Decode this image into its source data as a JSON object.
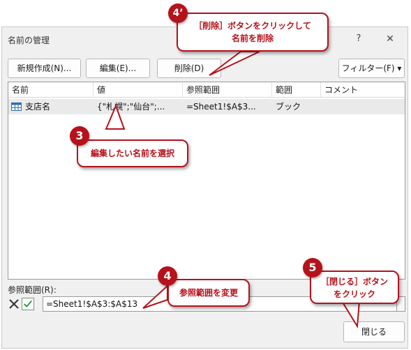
{
  "dialog": {
    "title": "名前の管理",
    "help": "?",
    "close_glyph": "✕"
  },
  "toolbar": {
    "new_label": "新規作成(N)...",
    "edit_label": "編集(E)...",
    "delete_label": "削除(D)",
    "filter_label": "フィルター(F) ▾"
  },
  "list": {
    "columns": [
      "名前",
      "値",
      "参照範囲",
      "範囲",
      "コメント"
    ],
    "rows": [
      {
        "name": "支店名",
        "value": "{\"札幌\";\"仙台\";...",
        "ref": "=Sheet1!$A$3...",
        "scope": "ブック",
        "comment": ""
      }
    ]
  },
  "reference": {
    "label": "参照範囲(R):",
    "value": "=Sheet1!$A$3:$A$13"
  },
  "footer": {
    "close_label": "閉じる"
  },
  "annotations": {
    "step3_number": "3",
    "step3_text": "編集したい名前を選択",
    "step4_number": "4",
    "step4_text": "参照範囲を変更",
    "step4p_number": "4’",
    "step4p_line1": "［削除］ボタンをクリックして",
    "step4p_line2": "名前を削除",
    "step5_number": "5",
    "step5_line1": "［閉じる］ボタン",
    "step5_line2": "をクリック",
    "accent_color": "#b5121b"
  }
}
